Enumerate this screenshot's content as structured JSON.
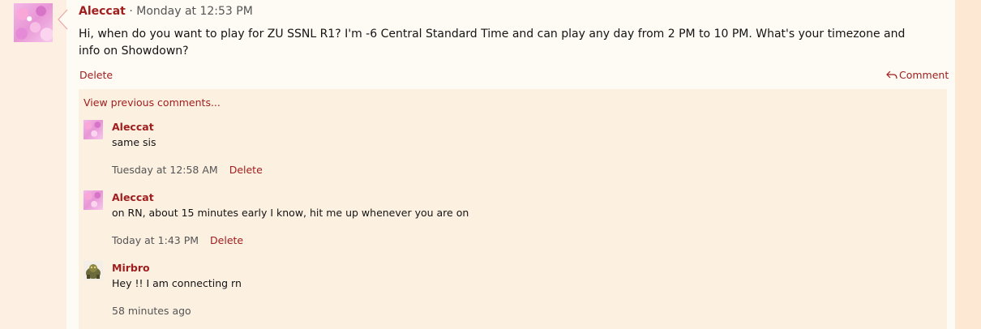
{
  "main_message": {
    "author": "Aleccat",
    "separator": " · ",
    "timestamp": "Monday at 12:53 PM",
    "body": "Hi, when do you want to play for ZU SSNL R1? I'm -6 Central Standard Time and can play any day from 2 PM to 10 PM. What's your timezone and info on Showdown?",
    "delete_label": "Delete",
    "comment_label": "Comment"
  },
  "view_previous_label": "View previous comments...",
  "comments": [
    {
      "author": "Aleccat",
      "text": "same sis",
      "timestamp": "Tuesday at 12:58 AM",
      "delete_label": "Delete"
    },
    {
      "author": "Aleccat",
      "text": "on RN, about 15 minutes early I know, hit me up whenever you are on",
      "timestamp": "Today at 1:43 PM",
      "delete_label": "Delete"
    },
    {
      "author": "Mirbro",
      "text": "Hey !! I am connecting rn",
      "timestamp": "58 minutes ago"
    }
  ],
  "colors": {
    "accent": "#a01e1e",
    "page_bg": "#fdf0e3",
    "panel_bg": "#fefaf4",
    "comments_bg": "#fcf0e1"
  }
}
